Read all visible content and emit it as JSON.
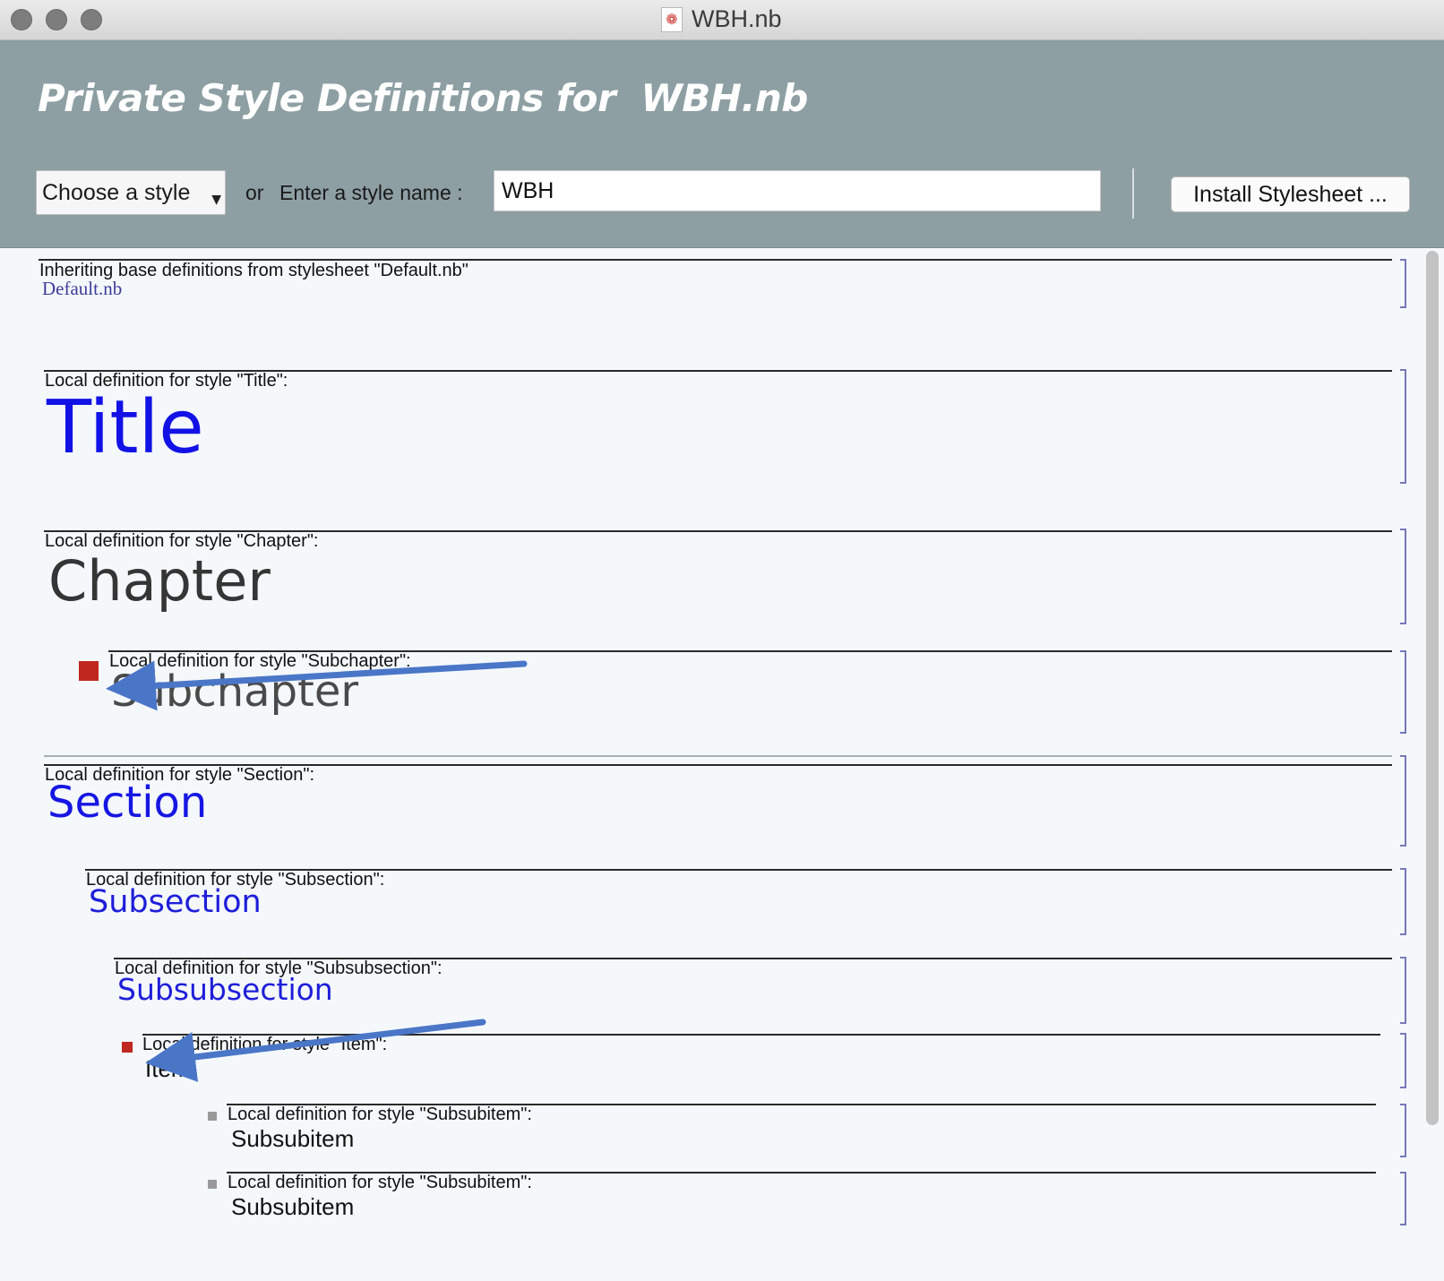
{
  "window": {
    "title": "WBH.nb",
    "doc_icon": "❁",
    "traffic_lights": [
      "close",
      "minimize",
      "zoom"
    ]
  },
  "header": {
    "title": "Private Style Definitions for  WBH.nb",
    "style_select": {
      "value": "Choose a style"
    },
    "or_label": "or",
    "enter_label": "Enter a style name :",
    "style_name_input": {
      "value": "WBH"
    },
    "install_button": "Install Stylesheet ..."
  },
  "content": {
    "inherit": {
      "label": "Inheriting base definitions from stylesheet \"Default.nb\"",
      "link": "Default.nb"
    },
    "definitions": [
      {
        "label": "Local definition for style \"Title\":",
        "sample": "Title"
      },
      {
        "label": "Local definition for style \"Chapter\":",
        "sample": "Chapter"
      },
      {
        "label": "Local definition for style \"Subchapter\":",
        "sample": "Subchapter"
      },
      {
        "label": "Local definition for style \"Section\":",
        "sample": "Section"
      },
      {
        "label": "Local definition for style \"Subsection\":",
        "sample": "Subsection"
      },
      {
        "label": "Local definition for style \"Subsubsection\":",
        "sample": "Subsubsection"
      },
      {
        "label": "Local definition for style \"Item\":",
        "sample": "Item"
      },
      {
        "label": "Local definition for style \"Subsubitem\":",
        "sample": "Subsubitem"
      },
      {
        "label": "Local definition for style \"Subsubitem\":",
        "sample": "Subsubitem"
      }
    ]
  },
  "colors": {
    "header_bg": "#8e9fa4",
    "sample_blue": "#1212e6",
    "cell_bracket": "#7679b6",
    "annotation_arrow": "#4a76c8",
    "marker_red": "#c0271f"
  }
}
